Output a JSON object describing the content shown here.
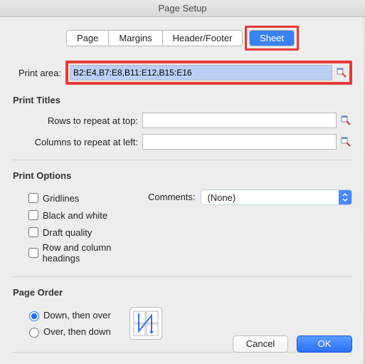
{
  "window": {
    "title": "Page Setup"
  },
  "tabs": {
    "page": "Page",
    "margins": "Margins",
    "headerfooter": "Header/Footer",
    "sheet": "Sheet"
  },
  "printArea": {
    "label": "Print area:",
    "value": "B2:E4,B7:E8,B11:E12,B15:E16"
  },
  "printTitles": {
    "heading": "Print Titles",
    "rowsLabel": "Rows to repeat at top:",
    "rowsValue": "",
    "colsLabel": "Columns to repeat at left:",
    "colsValue": ""
  },
  "printOptions": {
    "heading": "Print Options",
    "gridlines": "Gridlines",
    "bw": "Black and white",
    "draft": "Draft quality",
    "headings": "Row and column headings",
    "commentsLabel": "Comments:",
    "commentsValue": "(None)"
  },
  "pageOrder": {
    "heading": "Page Order",
    "downOver": "Down, then over",
    "overDown": "Over, then down"
  },
  "buttons": {
    "cancel": "Cancel",
    "ok": "OK"
  }
}
